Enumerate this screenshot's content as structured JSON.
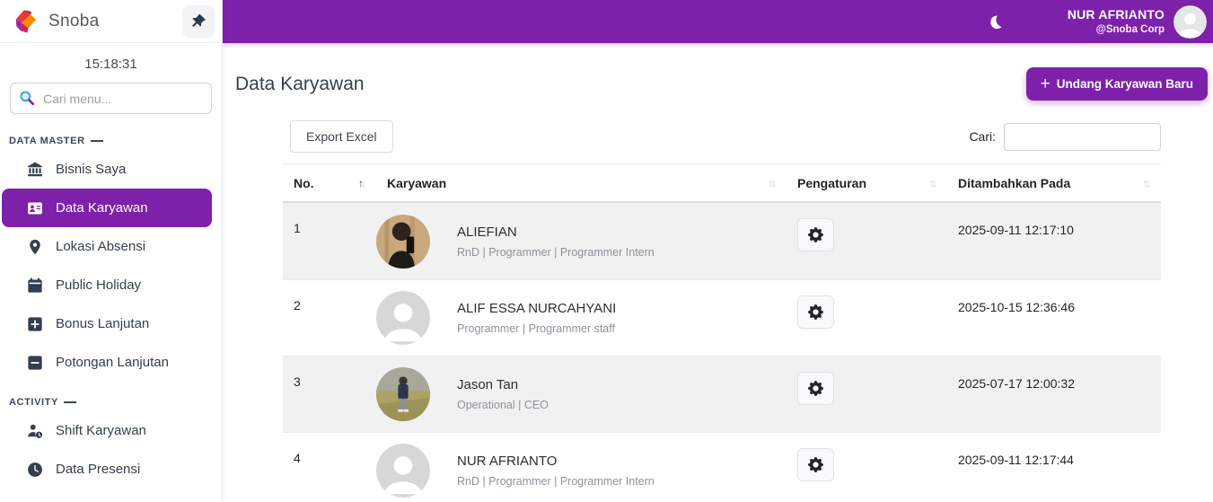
{
  "colors": {
    "accent": "#7d21ab",
    "stripe": "#f1f1f1",
    "muted_text": "#8d939b"
  },
  "sidebar": {
    "brand": "Snoba",
    "time": "15:18:31",
    "search_placeholder": "Cari menu...",
    "sections": [
      {
        "label": "DATA MASTER",
        "items": [
          {
            "label": "Bisnis Saya",
            "icon": "bank-icon",
            "active": false
          },
          {
            "label": "Data Karyawan",
            "icon": "id-card-icon",
            "active": true
          },
          {
            "label": "Lokasi Absensi",
            "icon": "map-pin-icon",
            "active": false
          },
          {
            "label": "Public Holiday",
            "icon": "calendar-icon",
            "active": false
          },
          {
            "label": "Bonus Lanjutan",
            "icon": "plus-square-icon",
            "active": false
          },
          {
            "label": "Potongan Lanjutan",
            "icon": "minus-square-icon",
            "active": false
          }
        ]
      },
      {
        "label": "ACTIVITY",
        "items": [
          {
            "label": "Shift Karyawan",
            "icon": "user-clock-icon",
            "active": false
          },
          {
            "label": "Data Presensi",
            "icon": "clock-icon",
            "active": false
          }
        ]
      }
    ]
  },
  "topbar": {
    "user_name": "NUR AFRIANTO",
    "user_org": "@Snoba Corp"
  },
  "page": {
    "title": "Data Karyawan",
    "invite_button": "Undang Karyawan Baru",
    "export_button": "Export Excel",
    "search_label": "Cari:"
  },
  "table": {
    "columns": [
      "No.",
      "Karyawan",
      "Pengaturan",
      "Ditambahkan Pada"
    ],
    "sort": {
      "column": "No.",
      "direction": "asc"
    },
    "rows": [
      {
        "no": "1",
        "name": "ALIEFIAN",
        "role": "RnD | Programmer | Programmer Intern",
        "added": "2025-09-11 12:17:10",
        "avatar": "photo-selfie"
      },
      {
        "no": "2",
        "name": "ALIF ESSA NURCAHYANI",
        "role": "Programmer | Programmer staff",
        "added": "2025-10-15 12:36:46",
        "avatar": "default"
      },
      {
        "no": "3",
        "name": "Jason Tan",
        "role": "Operational | CEO",
        "added": "2025-07-17 12:00:32",
        "avatar": "photo-field"
      },
      {
        "no": "4",
        "name": "NUR AFRIANTO",
        "role": "RnD | Programmer | Programmer Intern",
        "added": "2025-09-11 12:17:44",
        "avatar": "default"
      }
    ]
  }
}
